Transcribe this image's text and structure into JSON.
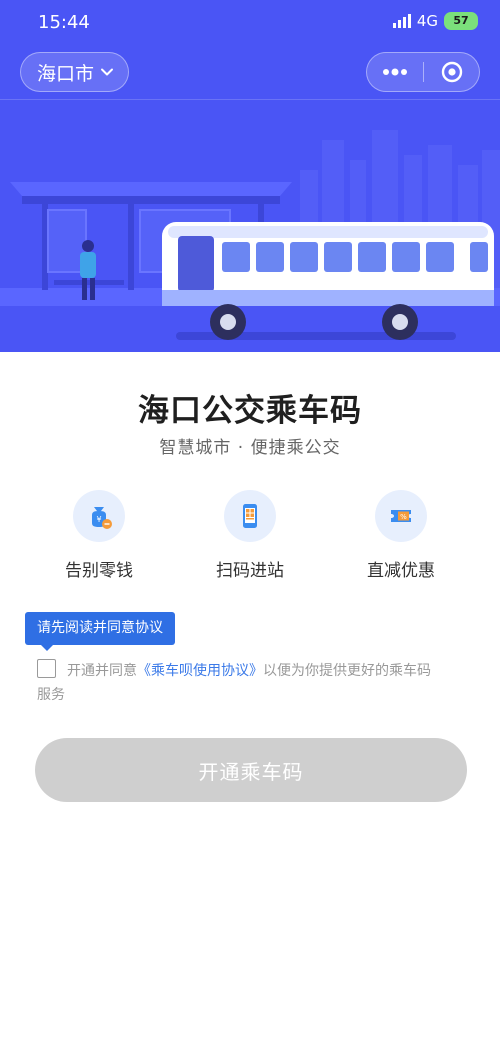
{
  "status": {
    "time": "15:44",
    "network": "4G",
    "battery": "57"
  },
  "nav": {
    "city": "海口市"
  },
  "header": {
    "title": "海口公交乘车码",
    "subtitle": "智慧城市 · 便捷乘公交"
  },
  "features": [
    {
      "label": "告别零钱",
      "icon": "money-bag-icon"
    },
    {
      "label": "扫码进站",
      "icon": "phone-qr-icon"
    },
    {
      "label": "直减优惠",
      "icon": "coupon-icon"
    }
  ],
  "agreement": {
    "tooltip": "请先阅读并同意协议",
    "prefix": "开通并同意",
    "link": "《乘车呗使用协议》",
    "suffix": "以便为你提供更好的乘车码",
    "suffix2": "服务",
    "checked": false
  },
  "button": {
    "label": "开通乘车码"
  },
  "colors": {
    "brand": "#4a55f5",
    "link": "#3b7ae8",
    "tooltip": "#2f6fe4",
    "disabled_button": "#cfcfcf"
  }
}
